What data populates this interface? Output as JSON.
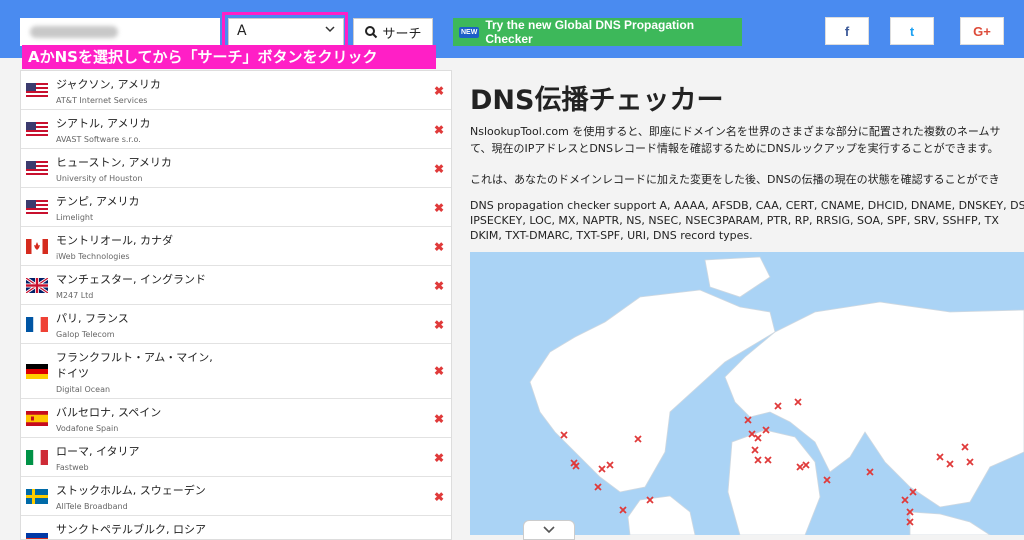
{
  "header": {
    "record_type": "A",
    "search_label": "サーチ",
    "promo_badge": "NEW",
    "promo_label": "Try the new Global DNS Propagation Checker",
    "social": [
      "f",
      "t",
      "G+"
    ]
  },
  "callout": "AかNSを選択してから「サーチ」ボタンをクリック",
  "servers": [
    {
      "location": "ジャクソン, アメリカ",
      "isp": "AT&T Internet Services",
      "flag": "us"
    },
    {
      "location": "シアトル, アメリカ",
      "isp": "AVAST Software s.r.o.",
      "flag": "us"
    },
    {
      "location": "ヒューストン, アメリカ",
      "isp": "University of Houston",
      "flag": "us"
    },
    {
      "location": "テンピ, アメリカ",
      "isp": "Limelight",
      "flag": "us"
    },
    {
      "location": "モントリオール, カナダ",
      "isp": "iWeb Technologies",
      "flag": "ca"
    },
    {
      "location": "マンチェスター, イングランド",
      "isp": "M247 Ltd",
      "flag": "uk"
    },
    {
      "location": "パリ, フランス",
      "isp": "Galop Telecom",
      "flag": "fr"
    },
    {
      "location": "フランクフルト・アム・マイン, ドイツ",
      "isp": "Digital Ocean",
      "flag": "de"
    },
    {
      "location": "バルセロナ, スペイン",
      "isp": "Vodafone Spain",
      "flag": "es"
    },
    {
      "location": "ローマ, イタリア",
      "isp": "Fastweb",
      "flag": "it"
    },
    {
      "location": "ストックホルム, スウェーデン",
      "isp": "AllTele Broadband",
      "flag": "se"
    },
    {
      "location": "サンクトペテルブルク, ロシア",
      "isp": "",
      "flag": "ru"
    }
  ],
  "status_mark": "✖",
  "main": {
    "title": "DNS伝播チェッカー",
    "p1_line1": "NslookupTool.com を使用すると、即座にドメイン名を世界のさまざまな部分に配置された複数のネームサ",
    "p1_line2": "て、現在のIPアドレスとDNSレコード情報を確認するためにDNSルックアップを実行することができます。",
    "p2": "これは、あなたのドメインレコードに加えた変更をした後、DNSの伝播の現在の状態を確認することができ",
    "p3_line1": "DNS propagation checker support A, AAAA, AFSDB, CAA, CERT, CNAME, DHCID, DNAME, DNSKEY, DS",
    "p3_line2": "IPSECKEY, LOC, MX, NAPTR, NS, NSEC, NSEC3PARAM, PTR, RP, RRSIG, SOA, SPF, SRV, SSHFP, TX",
    "p3_line3": "DKIM, TXT-DMARC, TXT-SPF, URI, DNS record types."
  },
  "colors": {
    "topbar": "#4a8bf0",
    "highlight": "#ff1fc6",
    "promo": "#3db85a",
    "fail": "#e03a3a",
    "ocean": "#aad3f5",
    "land": "#ffffff"
  },
  "icons": {
    "search": "search-icon",
    "chevron": "chevron-down-icon",
    "status": "x-icon",
    "collapse": "chevron-down-icon"
  }
}
